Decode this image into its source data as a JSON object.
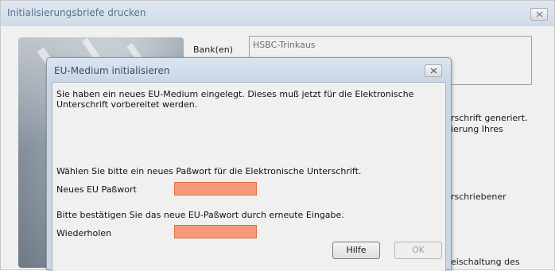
{
  "outer_window": {
    "title": "Initialisierungsbriefe drucken",
    "bank_label": "Bank(en)",
    "bank_value": "HSBC-Trinkaus",
    "fragments": {
      "line1": "rschrift generiert.",
      "line2": "ierung Ihres",
      "line3": "rschriebener",
      "line4": "eischaltung des"
    }
  },
  "dialog": {
    "title": "EU-Medium initialisieren",
    "intro_line1": "Sie haben ein neues EU-Medium eingelegt. Dieses muß jetzt für die Elektronische",
    "intro_line2": "Unterschrift vorbereitet werden.",
    "choose_password_text": "Wählen Sie bitte ein neues Paßwort für die Elektronische Unterschrift.",
    "new_password_label": "Neues EU Paßwort",
    "new_password_value": "",
    "confirm_text": "Bitte bestätigen Sie das neue EU-Paßwort durch erneute Eingabe.",
    "repeat_label": "Wiederholen",
    "repeat_value": "",
    "help_button": "Hilfe",
    "ok_button": "OK"
  }
}
